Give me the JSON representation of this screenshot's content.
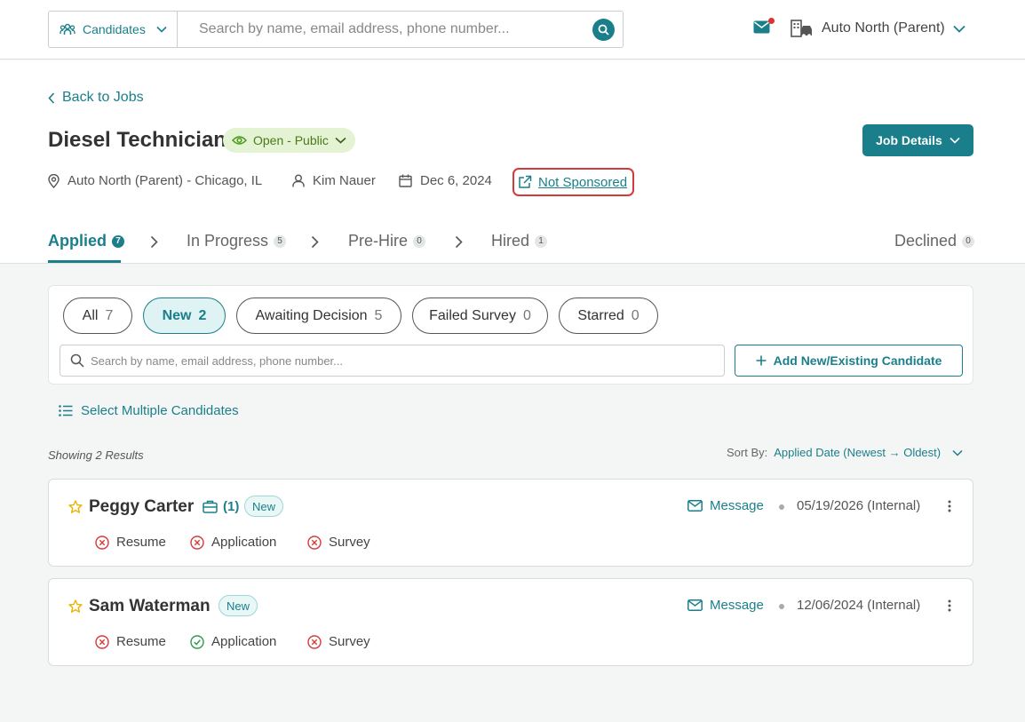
{
  "topbar": {
    "search_scope": "Candidates",
    "search_placeholder": "Search by name, email address, phone number...",
    "org_name": "Auto North (Parent)"
  },
  "header": {
    "back_label": "Back to Jobs",
    "job_title": "Diesel Technician",
    "status": "Open - Public",
    "job_details_label": "Job Details",
    "location": "Auto North (Parent) - Chicago, IL",
    "recruiter": "Kim Nauer",
    "date": "Dec 6, 2024",
    "sponsorship": "Not Sponsored"
  },
  "tabs": [
    {
      "label": "Applied",
      "count": "7"
    },
    {
      "label": "In Progress",
      "count": "5"
    },
    {
      "label": "Pre-Hire",
      "count": "0"
    },
    {
      "label": "Hired",
      "count": "1"
    },
    {
      "label": "Declined",
      "count": "0"
    }
  ],
  "filters": [
    {
      "label": "All",
      "count": "7"
    },
    {
      "label": "New",
      "count": "2"
    },
    {
      "label": "Awaiting Decision",
      "count": "5"
    },
    {
      "label": "Failed Survey",
      "count": "0"
    },
    {
      "label": "Starred",
      "count": "0"
    }
  ],
  "panel": {
    "search_placeholder": "Search by name, email address, phone number...",
    "add_label": "Add New/Existing Candidate"
  },
  "select_multiple_label": "Select Multiple Candidates",
  "showing_text": "Showing 2 Results",
  "sort": {
    "label": "Sort By:",
    "value": "Applied Date (Newest → Oldest)"
  },
  "candidates": [
    {
      "name": "Peggy Carter",
      "jobs_count": "(1)",
      "badge": "New",
      "message_label": "Message",
      "date": "05/19/2026 (Internal)",
      "requirements": [
        {
          "label": "Resume",
          "status": "failed"
        },
        {
          "label": "Application",
          "status": "failed"
        },
        {
          "label": "Survey",
          "status": "failed"
        }
      ]
    },
    {
      "name": "Sam Waterman",
      "badge": "New",
      "message_label": "Message",
      "date": "12/06/2024 (Internal)",
      "requirements": [
        {
          "label": "Resume",
          "status": "failed"
        },
        {
          "label": "Application",
          "status": "passed"
        },
        {
          "label": "Survey",
          "status": "failed"
        }
      ]
    }
  ],
  "colors": {
    "accent": "#1a7f8a",
    "error": "#d33a3a",
    "success": "#2e9a4a",
    "star": "#e8b400"
  }
}
